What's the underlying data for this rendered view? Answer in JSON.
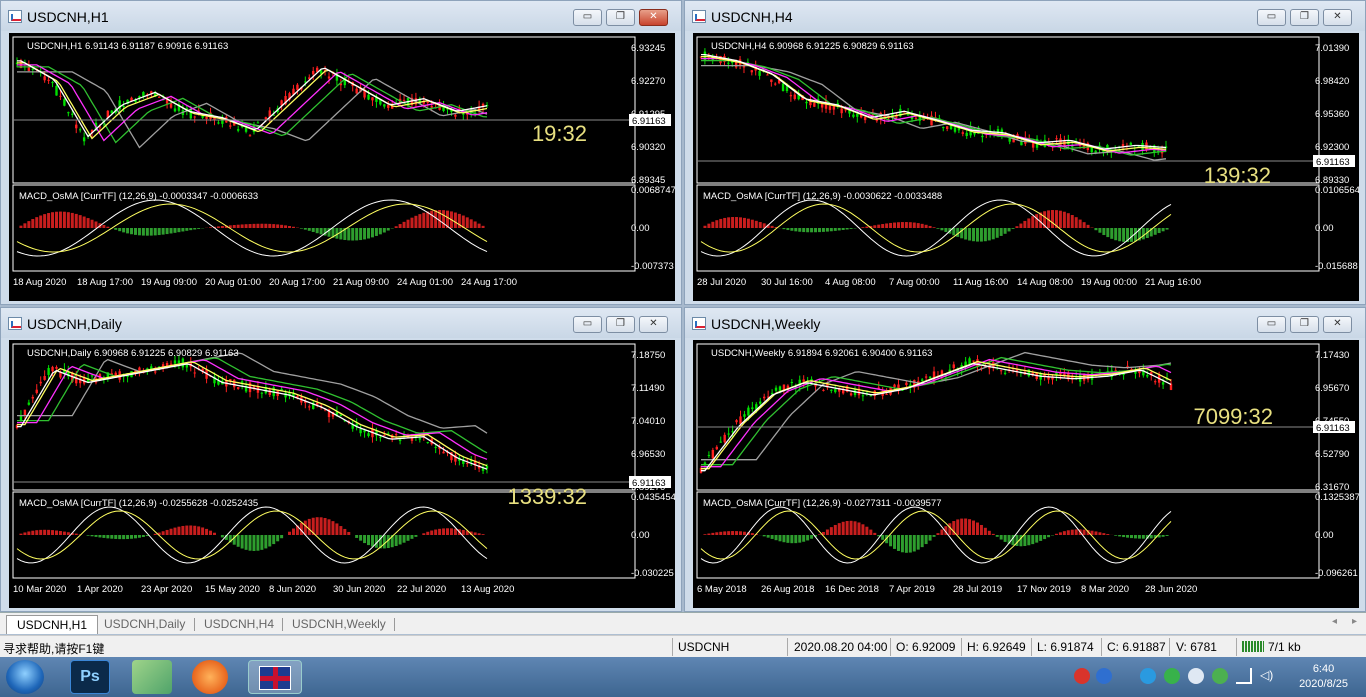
{
  "windows": [
    {
      "title": "USDCNH,H1",
      "active": true,
      "ohlc_label": "USDCNH,H1  6.91143 6.91187 6.90916 6.91163",
      "price_axis": [
        "6.93245",
        "6.92270",
        "6.91295",
        "6.90320",
        "6.89345"
      ],
      "current_price": "6.91163",
      "timer": "19:32",
      "macd_label": "MACD_OsMA [CurrTF] (12,26,9) -0.0003347 -0.0006633",
      "macd_axis": [
        "0.0068747",
        "0.00",
        "-0.007373"
      ],
      "time_axis": [
        "18 Aug 2020",
        "18 Aug 17:00",
        "19 Aug 09:00",
        "20 Aug 01:00",
        "20 Aug 17:00",
        "21 Aug 09:00",
        "24 Aug 01:00",
        "24 Aug 17:00"
      ]
    },
    {
      "title": "USDCNH,H4",
      "active": false,
      "ohlc_label": "USDCNH,H4  6.90968 6.91225 6.90829 6.91163",
      "price_axis": [
        "7.01390",
        "6.98420",
        "6.95360",
        "6.92300",
        "6.89330"
      ],
      "current_price": "6.91163",
      "timer": "139:32",
      "macd_label": "MACD_OsMA [CurrTF] (12,26,9) -0.0030622 -0.0033488",
      "macd_axis": [
        "0.0106564",
        "0.00",
        "-0.015688"
      ],
      "time_axis": [
        "28 Jul 2020",
        "30 Jul 16:00",
        "4 Aug 08:00",
        "7 Aug 00:00",
        "11 Aug 16:00",
        "14 Aug 08:00",
        "19 Aug 00:00",
        "21 Aug 16:00"
      ]
    },
    {
      "title": "USDCNH,Daily",
      "active": false,
      "ohlc_label": "USDCNH,Daily  6.90968 6.91225 6.90829 6.91163",
      "price_axis": [
        "7.18750",
        "7.11490",
        "7.04010",
        "6.96530",
        "6.89270"
      ],
      "current_price": "6.91163",
      "timer": "1339:32",
      "macd_label": "MACD_OsMA [CurrTF] (12,26,9) -0.0255628 -0.0252435",
      "macd_axis": [
        "0.0435454",
        "0.00",
        "-0.030225"
      ],
      "time_axis": [
        "10 Mar 2020",
        "1 Apr 2020",
        "23 Apr 2020",
        "15 May 2020",
        "8 Jun 2020",
        "30 Jun 2020",
        "22 Jul 2020",
        "13 Aug 2020"
      ]
    },
    {
      "title": "USDCNH,Weekly",
      "active": false,
      "ohlc_label": "USDCNH,Weekly  6.91894 6.92061 6.90400 6.91163",
      "price_axis": [
        "7.17430",
        "6.95670",
        "6.74550",
        "6.52790",
        "6.31670"
      ],
      "current_price": "6.91163",
      "timer": "7099:32",
      "macd_label": "MACD_OsMA [CurrTF] (12,26,9) -0.0277311 -0.0039577",
      "macd_axis": [
        "0.1325387",
        "0.00",
        "-0.096261"
      ],
      "time_axis": [
        "6 May 2018",
        "26 Aug 2018",
        "16 Dec 2018",
        "7 Apr 2019",
        "28 Jul 2019",
        "17 Nov 2019",
        "8 Mar 2020",
        "28 Jun 2020"
      ]
    }
  ],
  "window_buttons": {
    "minimize": "▭",
    "restore": "❐",
    "close": "✕"
  },
  "tabs": [
    {
      "label": "USDCNH,H1",
      "active": true
    },
    {
      "label": "USDCNH,Daily",
      "active": false
    },
    {
      "label": "USDCNH,H4",
      "active": false
    },
    {
      "label": "USDCNH,Weekly",
      "active": false
    }
  ],
  "tab_nav": {
    "prev": "◂",
    "next": "▸"
  },
  "statusbar": {
    "help": "寻求帮助,请按F1键",
    "symbol": "USDCNH",
    "datetime": "2020.08.20 04:00",
    "open": "O: 6.92009",
    "high": "H: 6.92649",
    "low": "L: 6.91874",
    "close": "C: 6.91887",
    "volume": "V: 6781",
    "traffic": "7/1 kb"
  },
  "taskbar": {
    "apps": [
      {
        "name": "start-orb-icon",
        "color": "#2f7fd4"
      },
      {
        "name": "photoshop-icon",
        "label": "Ps",
        "color": "#0b2a4a"
      },
      {
        "name": "map-app-icon",
        "color": "#4fa36a"
      },
      {
        "name": "browser-icon",
        "color": "#e8661e"
      },
      {
        "name": "metatrader-icon",
        "color": "#b0273a"
      }
    ],
    "time": "6:40",
    "date": "2020/8/25"
  },
  "colors": {
    "bull": "#00e000",
    "bear": "#ff2020",
    "macd_up": "#2e9e2e",
    "macd_down": "#c81e1e",
    "ma_fast": "#ffffff",
    "ma_yellow": "#ffff60",
    "ma_magenta": "#ff30ff",
    "ma_green": "#30c030",
    "ma_gray": "#a0a0a0",
    "timer": "#e8e080"
  }
}
